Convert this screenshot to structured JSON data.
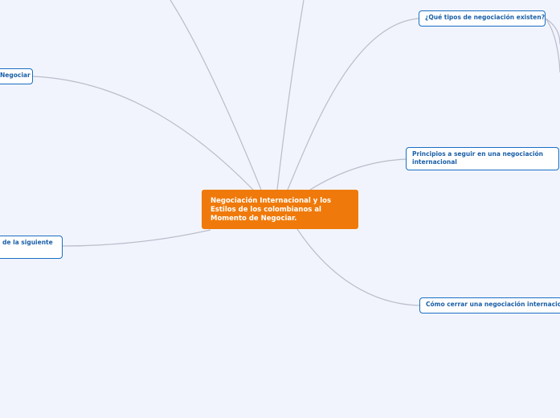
{
  "colors": {
    "background": "#f1f4fd",
    "central_fill": "#ef7a0b",
    "node_border": "#1a6fc4",
    "node_text": "#1a5fa8",
    "connector": "#b9bdc9"
  },
  "central_topic": {
    "line1": "Negociación Internacional  y los",
    "line2": "Estilos de los colombianos al",
    "line3": "Momento de Negociar."
  },
  "topics": {
    "tipos": "¿Qué tipos de negociación existen?",
    "principios_l1": "Principios a seguir en una negociación",
    "principios_l2": "internacional",
    "cerrar": "Cómo cerrar una negociación internacional",
    "left_top": "Negociar",
    "left_bottom": "de la siguiente"
  }
}
